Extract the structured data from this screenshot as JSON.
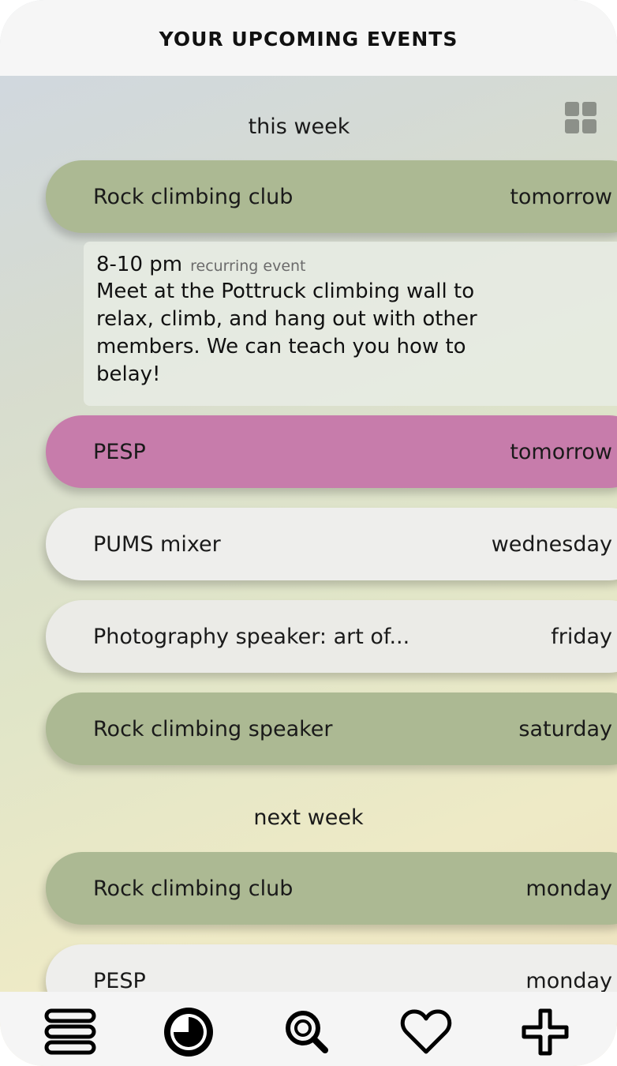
{
  "header": {
    "title": "YOUR UPCOMING EVENTS"
  },
  "sections": {
    "this_week": "this week",
    "next_week": "next week"
  },
  "events_this_week": [
    {
      "title": "Rock climbing club",
      "when": "tomorrow",
      "color": "#acb993"
    },
    {
      "title": "PESP",
      "when": "tomorrow",
      "color": "#c77cab"
    },
    {
      "title": "PUMS mixer",
      "when": "wednesday",
      "color": "#eeeeec"
    },
    {
      "title": "Photography speaker: art of...",
      "when": "friday",
      "color": "#ebebe7"
    },
    {
      "title": "Rock climbing speaker",
      "when": "saturday",
      "color": "#acb993"
    }
  ],
  "expanded_event": {
    "time": "8-10 pm",
    "tag": "recurring event",
    "description": "Meet at the Pottruck climbing wall to relax, climb, and hang out with other members. We can teach you how to belay!"
  },
  "events_next_week": [
    {
      "title": "Rock climbing club",
      "when": "monday",
      "color": "#acb993"
    },
    {
      "title": "PESP",
      "when": "monday",
      "color": "#eeeeec"
    }
  ],
  "toolbar": {
    "grid_icon": "grid-view-icon"
  },
  "navbar": {
    "icons": [
      "menu-icon",
      "clock-icon",
      "search-icon",
      "heart-icon",
      "plus-icon"
    ]
  }
}
